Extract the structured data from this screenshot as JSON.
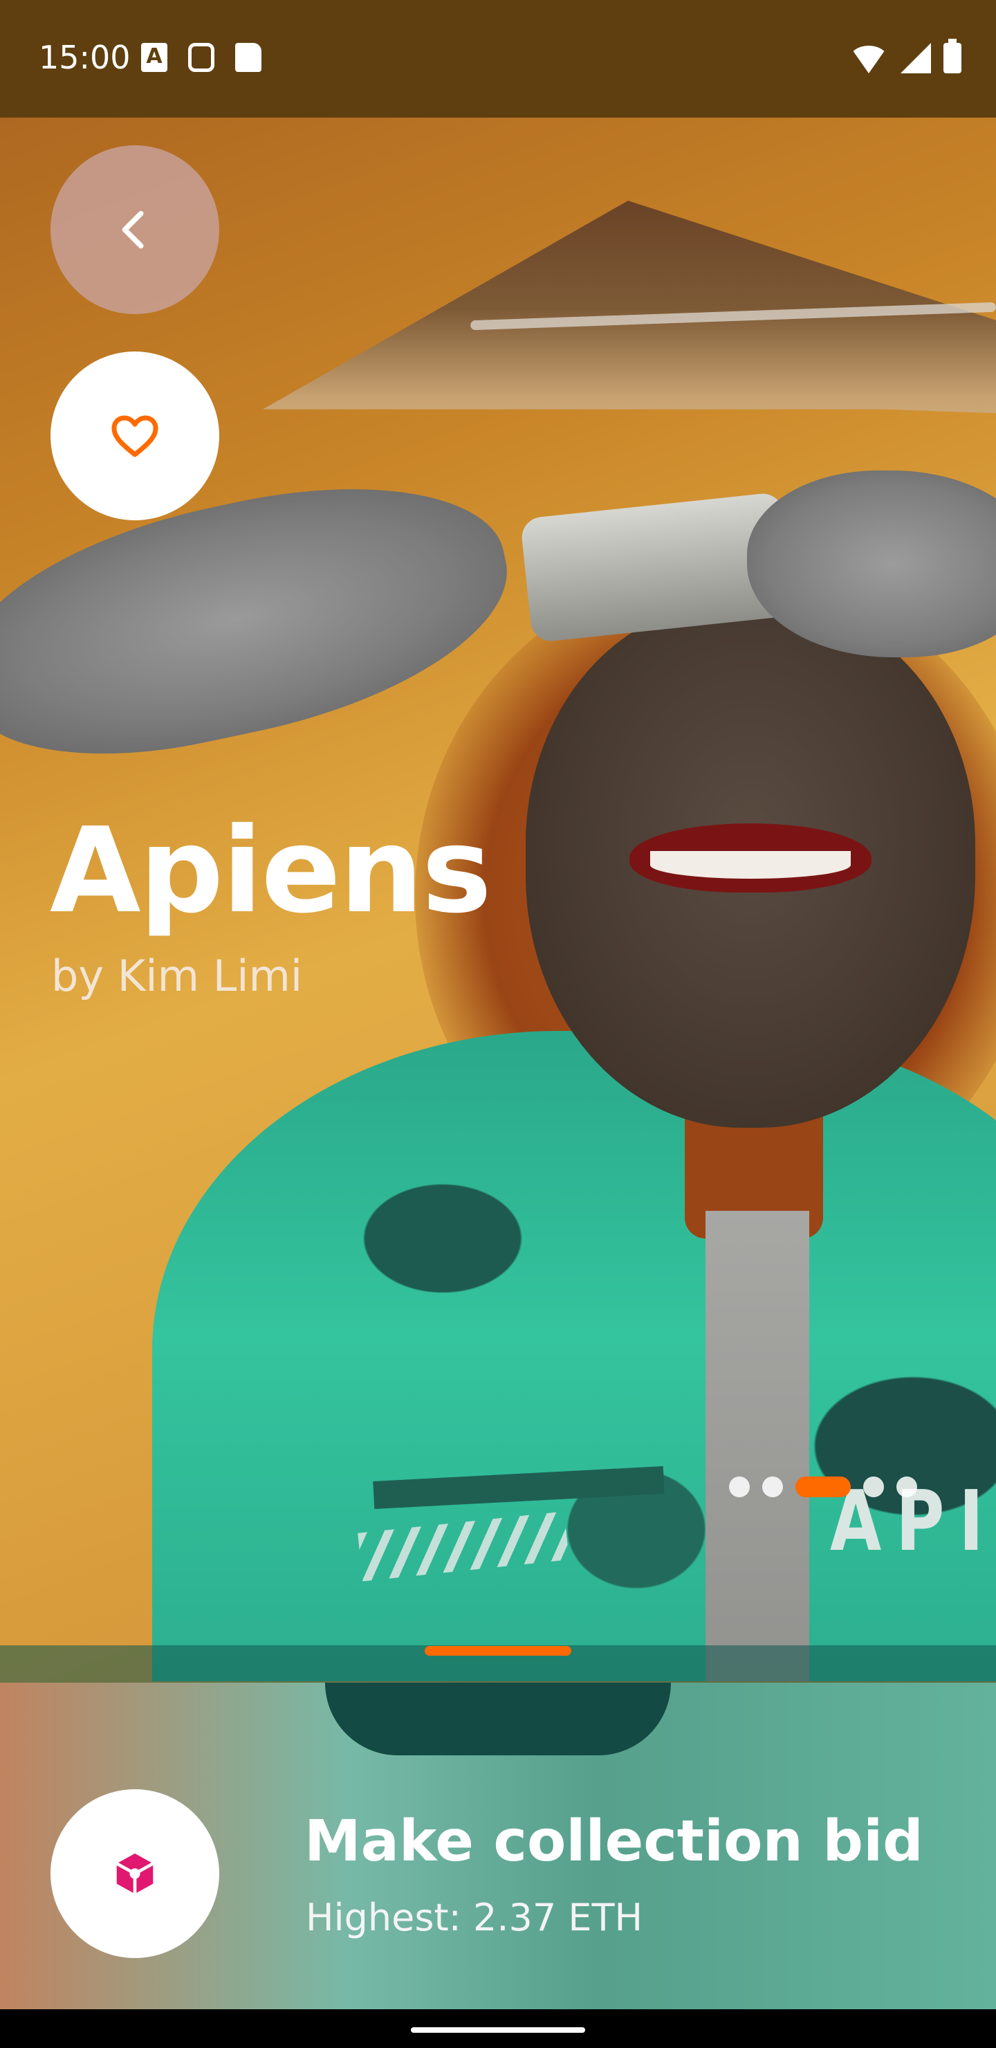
{
  "status_bar": {
    "time": "15:00",
    "left_icons": [
      "a-box-icon",
      "robot-icon",
      "sd-card-icon"
    ],
    "right_icons": [
      "wifi-icon",
      "signal-icon",
      "battery-icon"
    ]
  },
  "collection": {
    "title": "Apiens",
    "creator": "by Kim Limi"
  },
  "carousel": {
    "total": 5,
    "active_index": 2
  },
  "bid": {
    "label": "Make collection bid",
    "highest": "Highest: 2.37 ETH"
  },
  "colors": {
    "accent": "#ff6a00",
    "bid_icon": "#e0186f",
    "status_bar": "#5f3f10"
  },
  "icons": {
    "back": "chevron-left-icon",
    "favorite": "heart-icon",
    "bid": "cube-icon"
  }
}
